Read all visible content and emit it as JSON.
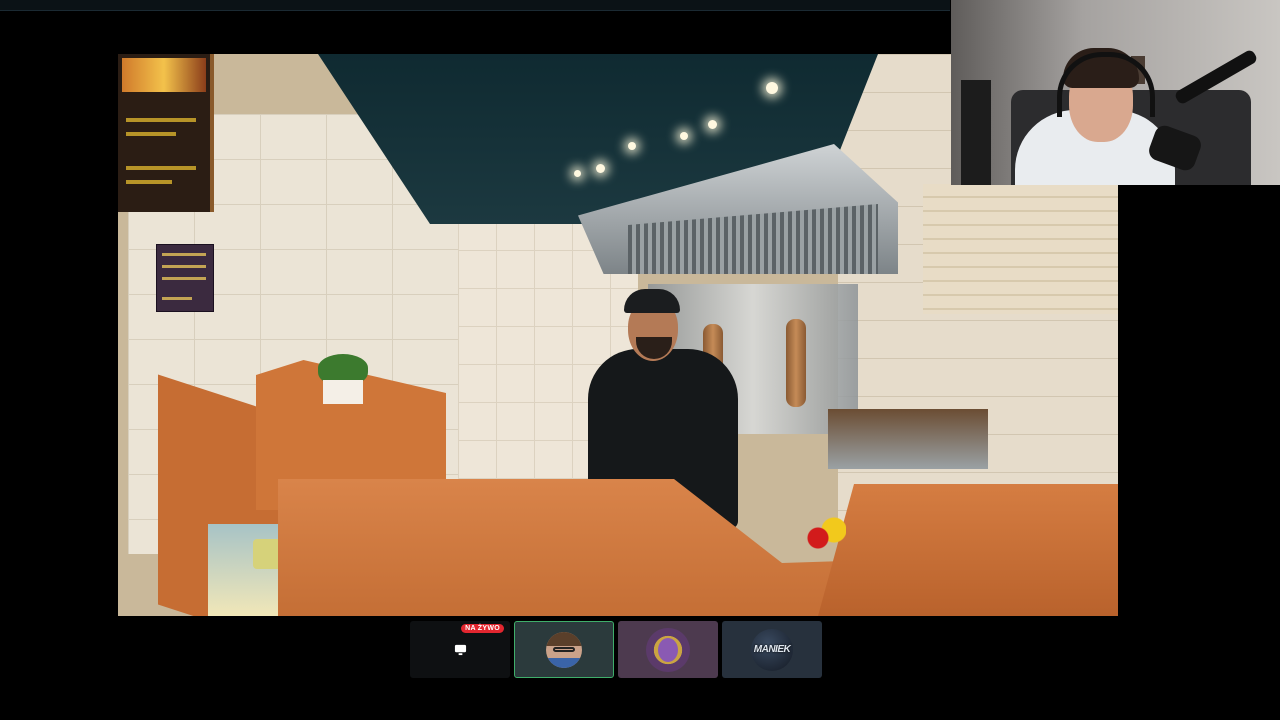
{
  "participants": {
    "live_badge": "NA ŻYWO",
    "tiles": [
      {
        "type": "screen-share",
        "icon": "screen-share-icon"
      },
      {
        "type": "camera-avatar",
        "icon": "user-avatar",
        "status": "active"
      },
      {
        "type": "avatar",
        "icon": "gold-frame-avatar"
      },
      {
        "type": "avatar",
        "icon": "dark-orb-avatar",
        "label": "MANIEK"
      }
    ]
  },
  "colors": {
    "live": "#e2262f",
    "active_border": "#3fae6a",
    "background": "#000000"
  }
}
